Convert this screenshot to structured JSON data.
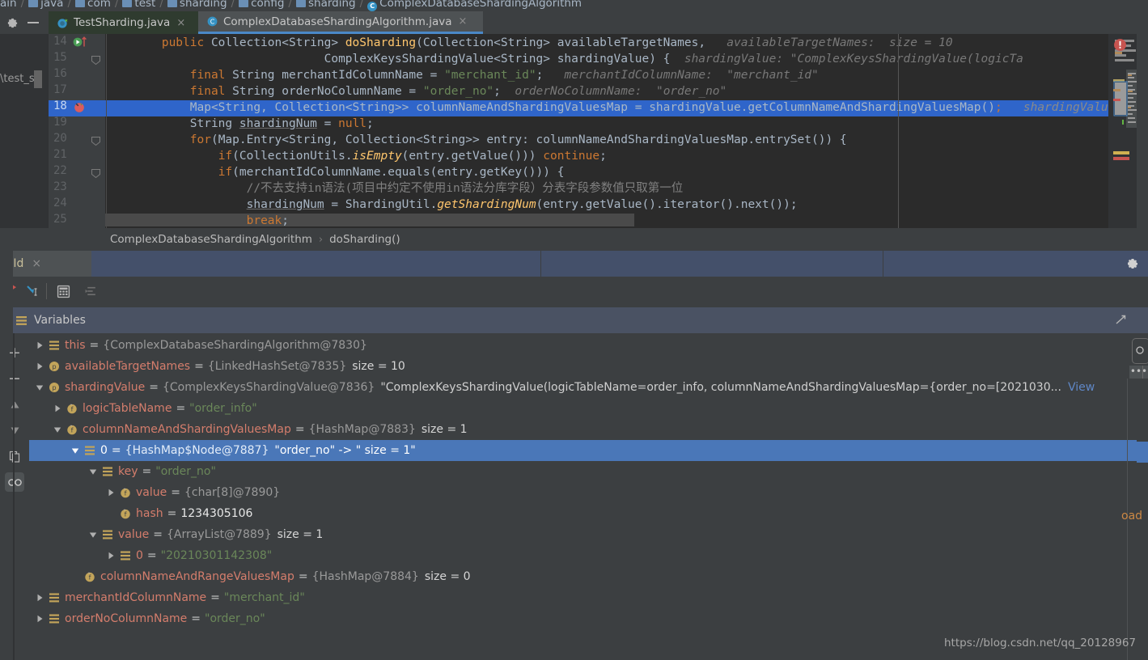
{
  "breadcrumb": {
    "items": [
      "ain",
      "java",
      "com",
      "test",
      "sharding",
      "config",
      "sharding",
      "ComplexDatabaseShardingAlgorithm"
    ],
    "separator": "/"
  },
  "window_controls": {
    "settings_icon": "gear-icon",
    "minimize_icon": "minimize-icon"
  },
  "tabs": [
    {
      "label": "TestSharding.java",
      "icon": "java-class-testng-icon",
      "close": "×",
      "active": false
    },
    {
      "label": "ComplexDatabaseShardingAlgorithm.java",
      "icon": "java-class-icon",
      "close": "×",
      "active": true
    }
  ],
  "editor": {
    "left_stub_label": "\\test_sh",
    "lines": [
      {
        "no": "14",
        "segments": [
          {
            "t": "        ",
            "c": "plain"
          },
          {
            "t": "public ",
            "c": "kw"
          },
          {
            "t": "Collection<String> ",
            "c": "plain"
          },
          {
            "t": "doSharding",
            "c": "mth"
          },
          {
            "t": "(Collection<String> availableTargetNames,",
            "c": "plain"
          },
          {
            "t": "   availableTargetNames:  size = 10",
            "c": "hint"
          }
        ]
      },
      {
        "no": "15",
        "segments": [
          {
            "t": "                               ComplexKeysShardingValue<String> shardingValue) {",
            "c": "plain"
          },
          {
            "t": "  shardingValue: \"ComplexKeysShardingValue(logicTa",
            "c": "hint"
          }
        ]
      },
      {
        "no": "16",
        "segments": [
          {
            "t": "            ",
            "c": "plain"
          },
          {
            "t": "final ",
            "c": "kw"
          },
          {
            "t": "String merchantIdColumnName = ",
            "c": "plain"
          },
          {
            "t": "\"merchant_id\"",
            "c": "str"
          },
          {
            "t": ";",
            "c": "plain"
          },
          {
            "t": "   merchantIdColumnName:  \"merchant_id\"",
            "c": "hint"
          }
        ]
      },
      {
        "no": "17",
        "segments": [
          {
            "t": "            ",
            "c": "plain"
          },
          {
            "t": "final ",
            "c": "kw"
          },
          {
            "t": "String orderNoColumnName = ",
            "c": "plain"
          },
          {
            "t": "\"order_no\"",
            "c": "str"
          },
          {
            "t": ";",
            "c": "plain"
          },
          {
            "t": "  orderNoColumnName:  \"order_no\"",
            "c": "hint"
          }
        ]
      },
      {
        "no": "18",
        "segments": [
          {
            "t": "            Map<String, Collection<String>> columnNameAndShardingValuesMap = shardingValue.getColumnNameAndShardingValuesMap()",
            "c": "plain"
          },
          {
            "t": ";",
            "c": "kw"
          },
          {
            "t": "   shardingValue:",
            "c": "hint2"
          }
        ]
      },
      {
        "no": "19",
        "segments": [
          {
            "t": "            String ",
            "c": "plain"
          },
          {
            "t": "shardingNum",
            "c": "u"
          },
          {
            "t": " = ",
            "c": "plain"
          },
          {
            "t": "null",
            "c": "kw"
          },
          {
            "t": ";",
            "c": "plain"
          }
        ]
      },
      {
        "no": "20",
        "segments": [
          {
            "t": "            ",
            "c": "plain"
          },
          {
            "t": "for",
            "c": "kw"
          },
          {
            "t": "(Map.Entry<String, Collection<String>> entry: columnNameAndShardingValuesMap.entrySet()) {",
            "c": "plain"
          }
        ]
      },
      {
        "no": "21",
        "segments": [
          {
            "t": "                ",
            "c": "plain"
          },
          {
            "t": "if",
            "c": "kw"
          },
          {
            "t": "(CollectionUtils.",
            "c": "plain"
          },
          {
            "t": "isEmpty",
            "c": "mthi"
          },
          {
            "t": "(entry.getValue())) ",
            "c": "plain"
          },
          {
            "t": "continue",
            "c": "kw"
          },
          {
            "t": ";",
            "c": "plain"
          }
        ]
      },
      {
        "no": "22",
        "segments": [
          {
            "t": "                ",
            "c": "plain"
          },
          {
            "t": "if",
            "c": "kw"
          },
          {
            "t": "(merchantIdColumnName.equals(entry.getKey())) {",
            "c": "plain"
          }
        ]
      },
      {
        "no": "23",
        "segments": [
          {
            "t": "                    //不去支持in语法(项目中约定不使用in语法分库字段）分表字段参数值只取第一位",
            "c": "cmt"
          }
        ]
      },
      {
        "no": "24",
        "segments": [
          {
            "t": "                    ",
            "c": "plain"
          },
          {
            "t": "shardingNum",
            "c": "u"
          },
          {
            "t": " = ShardingUtil.",
            "c": "plain"
          },
          {
            "t": "getShardingNum",
            "c": "mthi"
          },
          {
            "t": "(entry.getValue().iterator().next());",
            "c": "plain"
          }
        ]
      },
      {
        "no": "25",
        "segments": [
          {
            "t": "                    ",
            "c": "plain"
          },
          {
            "t": "break",
            "c": "kw"
          },
          {
            "t": ";",
            "c": "plain"
          }
        ]
      }
    ],
    "highlighted_line": "18",
    "gutter_marks": {
      "line14": "method-run-icon",
      "line18": "breakpoint-icon"
    }
  },
  "code_nav": {
    "class": "ComplexDatabaseShardingAlgorithm",
    "separator": "›",
    "method": "doSharding()"
  },
  "debug_tabs": {
    "active_label": "ntId",
    "close": "×",
    "settings_icon": "gear-icon"
  },
  "debug_toolbar": {
    "buttons": [
      {
        "name": "step-out-icon"
      },
      {
        "name": "run-to-cursor-icon"
      },
      {
        "name": "evaluate-expression-icon"
      },
      {
        "name": "show-execution-point-icon"
      }
    ]
  },
  "variables_panel": {
    "title": "Variables",
    "title_icon": "variables-icon",
    "collapse_icon": "collapse-panel-icon",
    "side_buttons": [
      {
        "name": "add-watch-button",
        "glyph": "+"
      },
      {
        "name": "remove-watch-button",
        "glyph": "−"
      },
      {
        "name": "move-up-button",
        "glyph": "▲"
      },
      {
        "name": "move-down-button",
        "glyph": "▼"
      },
      {
        "name": "copy-value-button",
        "glyph": "copy-icon"
      },
      {
        "name": "inspect-button",
        "glyph": "glasses-icon"
      }
    ],
    "rows": [
      {
        "indent": 0,
        "arrow": "collapsed",
        "icon": "object-icon",
        "name": "this",
        "eq": "=",
        "type": "{ComplexDatabaseShardingAlgorithm@7830}",
        "value": "",
        "size": "",
        "selected": false
      },
      {
        "indent": 0,
        "arrow": "collapsed",
        "icon": "param-icon",
        "name": "availableTargetNames",
        "eq": "=",
        "type": "{LinkedHashSet@7835}",
        "value": "",
        "size": "size = 10",
        "selected": false
      },
      {
        "indent": 0,
        "arrow": "expanded",
        "icon": "param-icon",
        "name": "shardingValue",
        "eq": "=",
        "type": "{ComplexKeysShardingValue@7836}",
        "value": "\"ComplexKeysShardingValue(logicTableName=order_info, columnNameAndShardingValuesMap={order_no=[2021030...",
        "link": "View",
        "size": "",
        "selected": false
      },
      {
        "indent": 1,
        "arrow": "collapsed",
        "icon": "field-icon",
        "name": "logicTableName",
        "eq": "=",
        "type": "",
        "value": "\"order_info\"",
        "size": "",
        "selected": false
      },
      {
        "indent": 1,
        "arrow": "expanded",
        "icon": "field-icon",
        "name": "columnNameAndShardingValuesMap",
        "eq": "=",
        "type": "{HashMap@7883}",
        "value": "",
        "size": "size = 1",
        "selected": false
      },
      {
        "indent": 2,
        "arrow": "expanded",
        "icon": "object-icon",
        "name": "0",
        "eq": "=",
        "type": "{HashMap$Node@7887}",
        "value": "\"order_no\" -> \" size = 1\"",
        "size": "",
        "selected": true
      },
      {
        "indent": 3,
        "arrow": "expanded",
        "icon": "object-icon",
        "name": "key",
        "eq": "=",
        "type": "",
        "value": "\"order_no\"",
        "size": "",
        "selected": false
      },
      {
        "indent": 4,
        "arrow": "collapsed",
        "icon": "field-icon",
        "name": "value",
        "eq": "=",
        "type": "{char[8]@7890}",
        "value": "",
        "size": "",
        "selected": false
      },
      {
        "indent": 4,
        "arrow": "none",
        "icon": "field-icon",
        "name": "hash",
        "eq": "=",
        "type": "",
        "value": "1234305106",
        "numeric": true,
        "size": "",
        "selected": false
      },
      {
        "indent": 3,
        "arrow": "expanded",
        "icon": "object-icon",
        "name": "value",
        "eq": "=",
        "type": "{ArrayList@7889}",
        "value": "",
        "size": "size = 1",
        "selected": false
      },
      {
        "indent": 4,
        "arrow": "collapsed",
        "icon": "object-icon",
        "name": "0",
        "eq": "=",
        "type": "",
        "value": "\"20210301142308\"",
        "size": "",
        "selected": false
      },
      {
        "indent": 2,
        "arrow": "none",
        "icon": "field-icon",
        "name": "columnNameAndRangeValuesMap",
        "eq": "=",
        "type": "{HashMap@7884}",
        "value": "",
        "size": "size = 0",
        "selected": false
      },
      {
        "indent": 0,
        "arrow": "collapsed",
        "icon": "object-icon",
        "name": "merchantIdColumnName",
        "eq": "=",
        "type": "",
        "value": "\"merchant_id\"",
        "size": "",
        "selected": false
      },
      {
        "indent": 0,
        "arrow": "collapsed",
        "icon": "object-icon",
        "name": "orderNoColumnName",
        "eq": "=",
        "type": "",
        "value": "\"order_no\"",
        "size": "",
        "selected": false
      }
    ]
  },
  "right_overlay": {
    "truncated_label": "oad",
    "dots": "•••"
  },
  "watermark": "https://blog.csdn.net/qq_20128967",
  "colors": {
    "editor_bg": "#2b2b2b",
    "panel_bg": "#3c3f41",
    "selection_blue": "#4a77b8",
    "code_selection": "#2f65ca",
    "accent_tab": "#4a88c7",
    "var_name": "#d47d6c",
    "string_green": "#6a8759",
    "keyword_orange": "#cc7832"
  }
}
